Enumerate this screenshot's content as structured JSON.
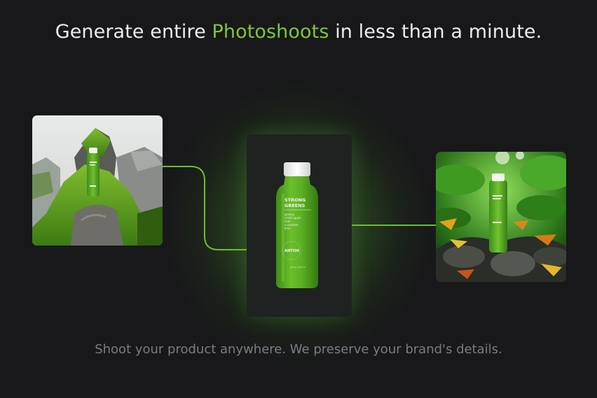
{
  "headline": {
    "before": "Generate entire",
    "accent": "Photoshoots",
    "after": "in less than a minute."
  },
  "subline": "Shoot your product anywhere. We preserve your brand's details.",
  "product_label": {
    "brand_top": "STRONG",
    "brand_bottom": "GREENS",
    "ingredients": [
      "granny",
      "smith apple",
      "kale",
      "cucumber",
      "lime"
    ],
    "maker": "ANTIOX",
    "volume": "16 oz / 473 ml"
  },
  "colors": {
    "accent": "#7ec63a",
    "background": "#18181a",
    "connector": "#6cbf2e"
  },
  "images": {
    "left": "moss-rock-scene",
    "center": "product-bottle-cutout",
    "right": "jungle-leaves-scene"
  }
}
